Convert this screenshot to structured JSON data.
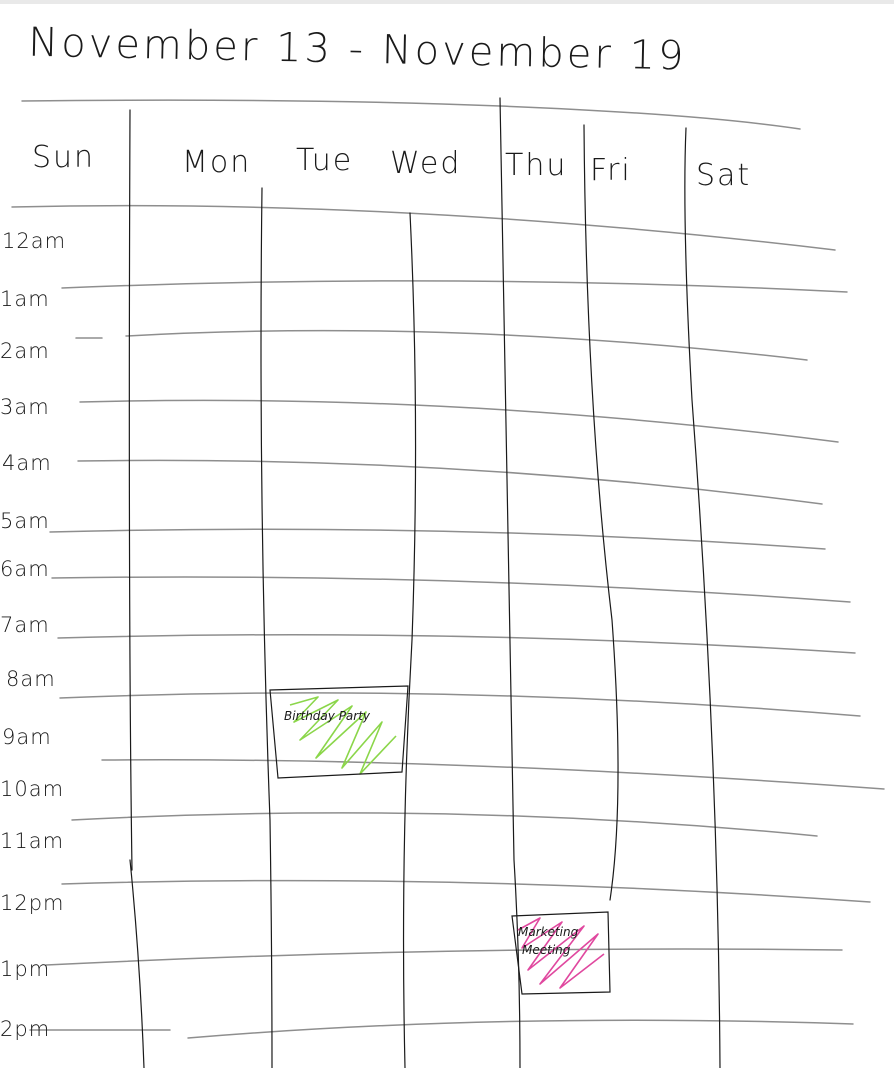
{
  "title": "November 13 - November 19",
  "days": [
    "Sun",
    "Mon",
    "Tue",
    "Wed",
    "Thu",
    "Fri",
    "Sat"
  ],
  "hours": [
    "12am",
    "1am",
    "2am",
    "3am",
    "4am",
    "5am",
    "6am",
    "7am",
    "8am",
    "9am",
    "10am",
    "11am",
    "12pm",
    "1pm",
    "2pm"
  ],
  "events": [
    {
      "label": "Birthday Party",
      "day": "Tue",
      "color": "#8bd64a"
    },
    {
      "label": "Marketing Meeting",
      "day": "Thu",
      "color": "#e0489f"
    }
  ]
}
